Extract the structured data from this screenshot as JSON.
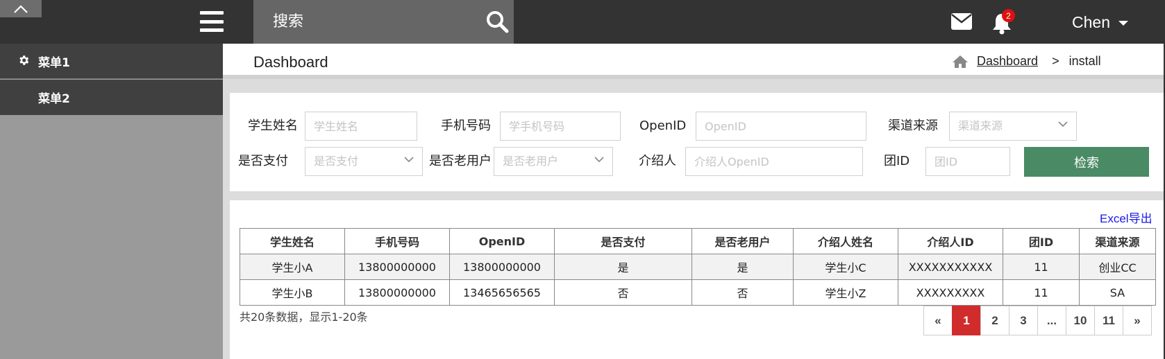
{
  "topbar": {
    "search_placeholder": "搜索",
    "notification_count": "2",
    "user_name": "Chen"
  },
  "sidebar": {
    "items": [
      {
        "label": "菜单1",
        "icon": "gear-icon"
      },
      {
        "label": "菜单2"
      }
    ]
  },
  "header": {
    "title": "Dashboard",
    "breadcrumb": {
      "home_link": "Dashboard",
      "separator": ">",
      "current": "install"
    }
  },
  "filters": {
    "student_name": {
      "label": "学生姓名",
      "placeholder": "学生姓名"
    },
    "phone": {
      "label": "手机号码",
      "placeholder": "学手机号码"
    },
    "openid": {
      "label": "OpenID",
      "placeholder": "OpenID"
    },
    "channel": {
      "label": "渠道来源",
      "placeholder": "渠道来源"
    },
    "paid": {
      "label": "是否支付",
      "placeholder": "是否支付"
    },
    "old_user": {
      "label": "是否老用户",
      "placeholder": "是否老用户"
    },
    "referrer": {
      "label": "介绍人",
      "placeholder": "介绍人OpenID"
    },
    "group_id": {
      "label": "团ID",
      "placeholder": "团ID"
    },
    "search_button": "检索"
  },
  "table": {
    "export_link": "Excel导出",
    "headers": [
      "学生姓名",
      "手机号码",
      "OpenID",
      "是否支付",
      "是否老用户",
      "介绍人姓名",
      "介绍人ID",
      "团ID",
      "渠道来源"
    ],
    "rows": [
      [
        "学生小A",
        "13800000000",
        "13800000000",
        "是",
        "是",
        "学生小C",
        "XXXXXXXXXXX",
        "11",
        "创业CC"
      ],
      [
        "学生小B",
        "13800000000",
        "13465656565",
        "否",
        "否",
        "学生小Z",
        "XXXXXXXXX",
        "11",
        "SA"
      ]
    ],
    "summary": "共20条数据，显示1-20条"
  },
  "pagination": {
    "prev": "«",
    "pages": [
      "1",
      "2",
      "3",
      "...",
      "10",
      "11"
    ],
    "next": "»",
    "active": "1"
  },
  "colors": {
    "topbar_bg": "#333333",
    "search_bg": "#666666",
    "sidebar_bg": "#9a9a9a",
    "sidebar_item_bg": "#404040",
    "search_button": "#4a8a65",
    "pagination_active": "#d12c2c",
    "badge": "#e01010",
    "export_link": "#1a1ae8"
  }
}
